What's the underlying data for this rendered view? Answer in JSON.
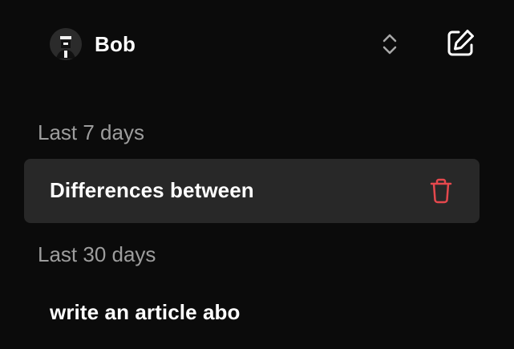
{
  "user": {
    "name": "Bob",
    "avatar_icon": "user-avatar-icon"
  },
  "icons": {
    "switch": "chevron-up-down-icon",
    "new_chat": "edit-icon",
    "delete": "trash-icon"
  },
  "colors": {
    "background": "#0b0b0b",
    "active_item": "#282828",
    "delete": "#e5484d",
    "muted_text": "#9d9d9d"
  },
  "sections": [
    {
      "label": "Last 7 days",
      "items": [
        {
          "title": "Differences between",
          "active": true
        }
      ]
    },
    {
      "label": "Last 30 days",
      "items": [
        {
          "title": "write an article abo",
          "active": false
        }
      ]
    }
  ]
}
